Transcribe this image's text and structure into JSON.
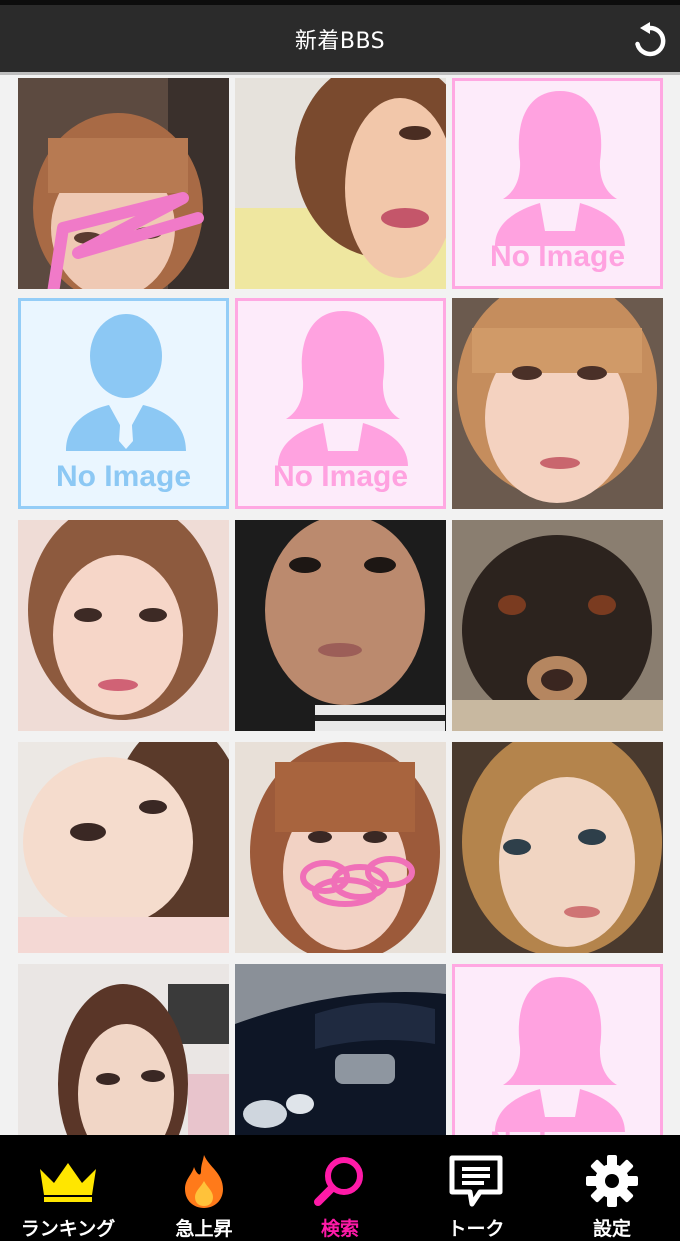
{
  "header": {
    "title": "新着BBS",
    "refresh_icon": "refresh-icon"
  },
  "grid": {
    "no_image_label": "No Image",
    "tiles": [
      {
        "kind": "photo",
        "desc": "female-photo-scribbled"
      },
      {
        "kind": "photo",
        "desc": "female-photo"
      },
      {
        "kind": "no-image",
        "gender": "female"
      },
      {
        "kind": "no-image",
        "gender": "male"
      },
      {
        "kind": "no-image",
        "gender": "female"
      },
      {
        "kind": "photo",
        "desc": "female-photo"
      },
      {
        "kind": "photo",
        "desc": "female-photo"
      },
      {
        "kind": "photo",
        "desc": "female-photo"
      },
      {
        "kind": "photo",
        "desc": "dog-photo"
      },
      {
        "kind": "photo",
        "desc": "female-photo"
      },
      {
        "kind": "photo",
        "desc": "female-photo-scribbled"
      },
      {
        "kind": "photo",
        "desc": "female-photo"
      },
      {
        "kind": "photo",
        "desc": "female-photo"
      },
      {
        "kind": "photo",
        "desc": "car-photo"
      },
      {
        "kind": "no-image",
        "gender": "female"
      }
    ]
  },
  "tabbar": {
    "tabs": [
      {
        "label": "ランキング",
        "icon": "crown-icon",
        "active": false
      },
      {
        "label": "急上昇",
        "icon": "flame-icon",
        "active": false
      },
      {
        "label": "検索",
        "icon": "search-icon",
        "active": true
      },
      {
        "label": "トーク",
        "icon": "chat-icon",
        "active": false
      },
      {
        "label": "設定",
        "icon": "gear-icon",
        "active": false
      }
    ]
  },
  "colors": {
    "header_bg": "#2b2b2b",
    "active_tab": "#ff1aa8",
    "no_image_female": "#ffa2e0",
    "no_image_male": "#8cc8f4"
  }
}
